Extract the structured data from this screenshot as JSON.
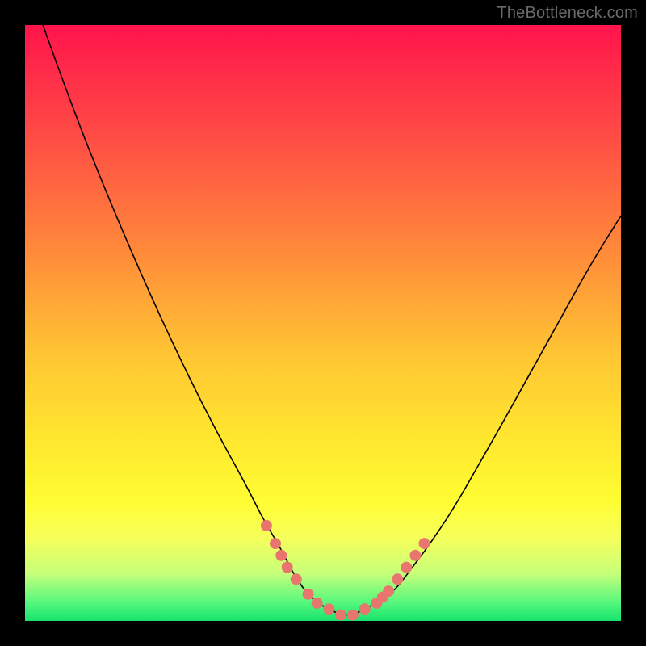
{
  "watermark": "TheBottleneck.com",
  "colors": {
    "page_bg": "#000000",
    "curve": "#000000",
    "dot": "#e9766e"
  },
  "chart_data": {
    "type": "line",
    "title": "",
    "xlabel": "",
    "ylabel": "",
    "xlim": [
      0,
      100
    ],
    "ylim": [
      0,
      100
    ],
    "grid": false,
    "series": [
      {
        "name": "bottleneck-curve",
        "x": [
          3,
          8,
          14,
          20,
          26,
          32,
          37,
          40,
          43,
          45,
          47,
          49,
          51,
          53,
          55,
          57,
          59,
          62,
          65,
          68,
          72,
          76,
          80,
          85,
          90,
          95,
          100
        ],
        "y": [
          100,
          86,
          71,
          57,
          44,
          32,
          23,
          17,
          12,
          8,
          5,
          3,
          2,
          1,
          1,
          2,
          3,
          5,
          9,
          13,
          19,
          26,
          33,
          42,
          51,
          60,
          68
        ]
      }
    ],
    "markers": {
      "name": "highlighted-points",
      "x_values": [
        40.5,
        42,
        43,
        44,
        45.5,
        47.5,
        49,
        51,
        53,
        55,
        57,
        59,
        60,
        61,
        62.5,
        64,
        65.5,
        67
      ],
      "y_values": [
        16,
        13,
        11,
        9,
        7,
        4.5,
        3,
        2,
        1,
        1,
        2,
        3,
        4,
        5,
        7,
        9,
        11,
        13
      ]
    }
  }
}
